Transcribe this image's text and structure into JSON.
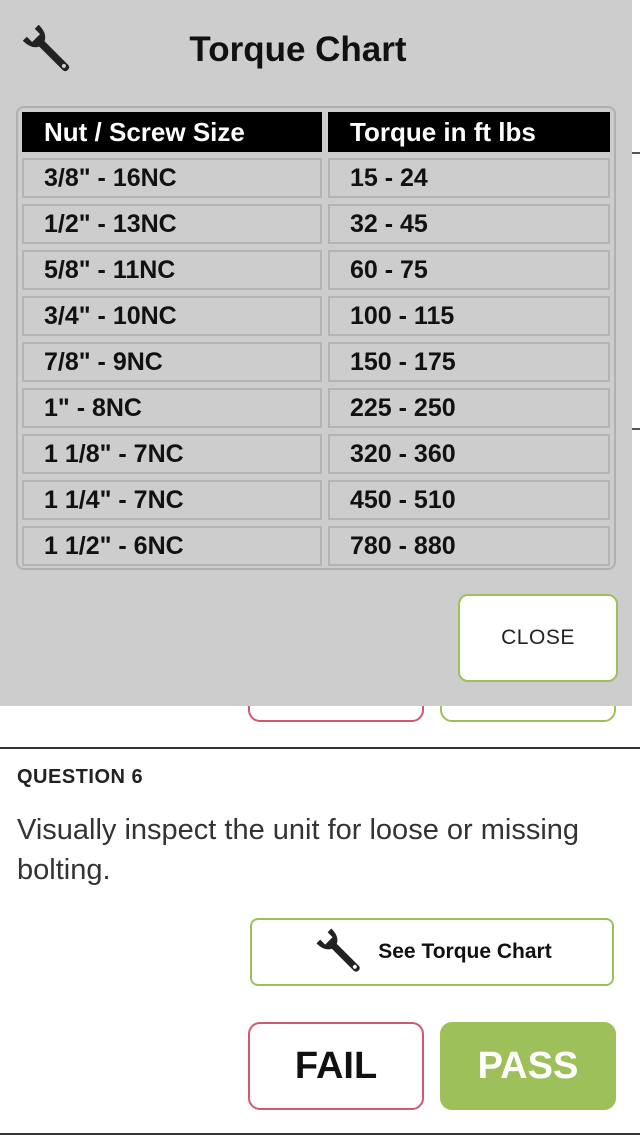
{
  "modal": {
    "title": "Torque Chart",
    "close_label": "CLOSE",
    "wrench_icon": "wrench-icon",
    "table": {
      "headers": [
        "Nut / Screw Size",
        "Torque in ft lbs"
      ],
      "rows": [
        [
          "3/8\" - 16NC",
          "15 - 24"
        ],
        [
          "1/2\" - 13NC",
          "32 - 45"
        ],
        [
          "5/8\" - 11NC",
          "60 - 75"
        ],
        [
          "3/4\" - 10NC",
          "100 - 115"
        ],
        [
          "7/8\" - 9NC",
          "150 - 175"
        ],
        [
          "1\" - 8NC",
          "225 - 250"
        ],
        [
          "1 1/8\" - 7NC",
          "320 - 360"
        ],
        [
          "1 1/4\" - 7NC",
          "450 - 510"
        ],
        [
          "1 1/2\" - 6NC",
          "780 - 880"
        ]
      ]
    }
  },
  "question": {
    "label": "QUESTION 6",
    "text": "Visually inspect the unit for loose or missing bolting.",
    "torque_button_label": "See Torque Chart",
    "fail_label": "FAIL",
    "pass_label": "PASS"
  },
  "colors": {
    "accent_green": "#9dc05a",
    "fail_red": "#cc5a72",
    "modal_bg": "#cdcdcd"
  }
}
